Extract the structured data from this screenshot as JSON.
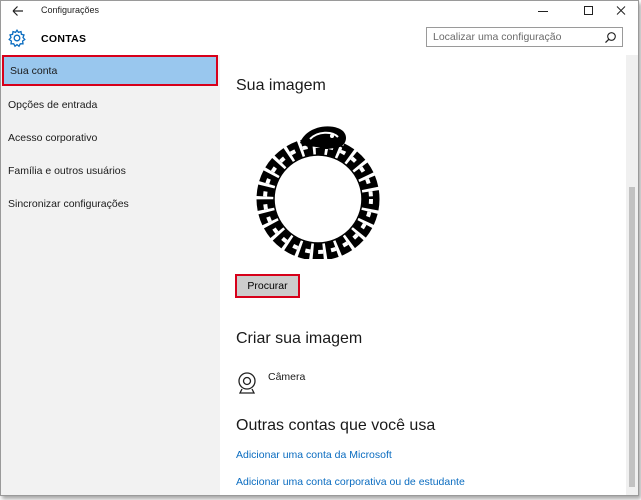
{
  "window": {
    "title": "Configurações"
  },
  "header": {
    "section_title": "CONTAS",
    "search_placeholder": "Localizar uma configuração"
  },
  "sidebar": {
    "items": [
      {
        "label": "Sua conta",
        "selected": true
      },
      {
        "label": "Opções de entrada",
        "selected": false
      },
      {
        "label": "Acesso corporativo",
        "selected": false
      },
      {
        "label": "Família e outros usuários",
        "selected": false
      },
      {
        "label": "Sincronizar configurações",
        "selected": false
      }
    ]
  },
  "main": {
    "your_picture_heading": "Sua imagem",
    "browse_button": "Procurar",
    "create_picture_heading": "Criar sua imagem",
    "camera_label": "Câmera",
    "other_accounts_heading": "Outras contas que você usa",
    "links": [
      "Adicionar uma conta da Microsoft",
      "Adicionar uma conta corporativa ou de estudante"
    ]
  },
  "colors": {
    "accent": "#0a6cc0",
    "selected_bg": "#99c7ee",
    "highlight_border": "#d7001a",
    "sidebar_bg": "#f2f2f2"
  },
  "icons": [
    "back-arrow-icon",
    "minimize-icon",
    "maximize-icon",
    "close-icon",
    "gear-icon",
    "search-icon",
    "camera-icon",
    "ouroboros-avatar"
  ]
}
